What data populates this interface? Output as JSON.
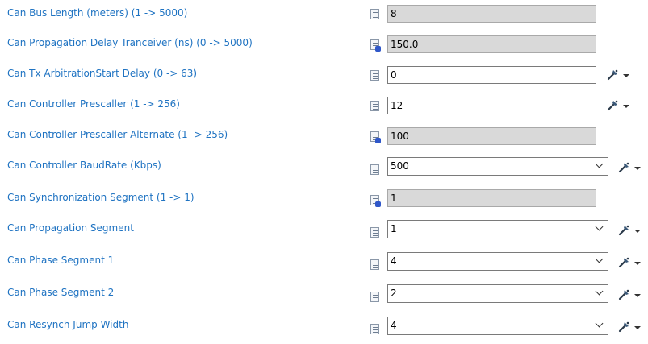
{
  "rows": [
    {
      "label": "Can Bus Length (meters) (1 -> 5000)",
      "value": "8",
      "kind": "text-readonly"
    },
    {
      "label": "Can Propagation Delay Tranceiver (ns) (0 -> 5000)",
      "value": "150.0",
      "kind": "text-readonly"
    },
    {
      "label": "Can Tx ArbitrationStart Delay (0 -> 63)",
      "value": "0",
      "kind": "text-editable"
    },
    {
      "label": "Can Controller Prescaller (1 -> 256)",
      "value": "12",
      "kind": "text-editable"
    },
    {
      "label": "Can Controller Prescaller Alternate (1 -> 256)",
      "value": "100",
      "kind": "text-readonly"
    },
    {
      "label": "Can Controller BaudRate (Kbps)",
      "value": "500",
      "kind": "combo"
    },
    {
      "label": "Can Synchronization Segment (1 -> 1)",
      "value": "1",
      "kind": "text-readonly"
    },
    {
      "label": "Can Propagation Segment",
      "value": "1",
      "kind": "combo"
    },
    {
      "label": "Can Phase Segment 1",
      "value": "4",
      "kind": "combo"
    },
    {
      "label": "Can Phase Segment 2",
      "value": "2",
      "kind": "combo"
    },
    {
      "label": "Can Resynch Jump Width",
      "value": "4",
      "kind": "combo"
    }
  ],
  "icons": {
    "doc": "document-icon",
    "tool": "magic-wand-icon",
    "dropdown": "dropdown-arrow-icon"
  },
  "colors": {
    "label": "#1f73c2",
    "readonly_bg": "#d9d9d9",
    "border": "#7a7a7a"
  }
}
